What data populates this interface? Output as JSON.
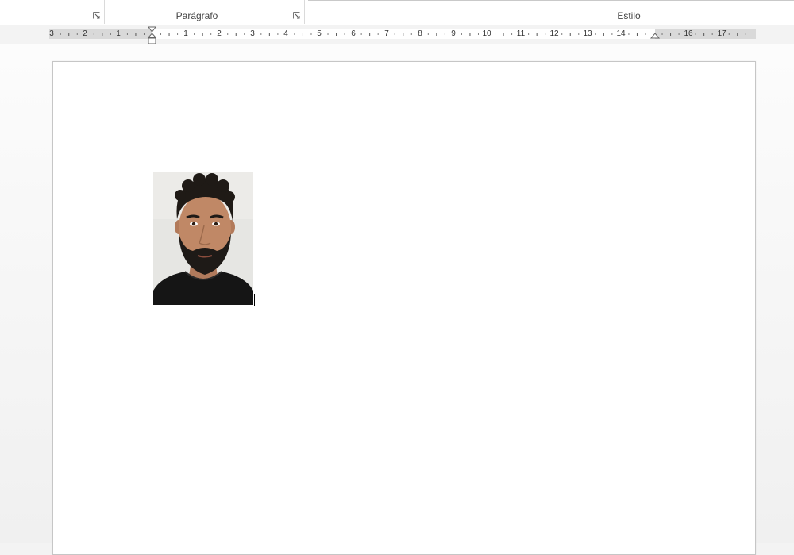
{
  "ribbon": {
    "groups": [
      {
        "label": ""
      },
      {
        "label": "Parágrafo"
      },
      {
        "label": "Estilo"
      }
    ]
  },
  "ruler": {
    "left_numbers": [
      "3",
      "2",
      "1"
    ],
    "right_numbers": [
      "1",
      "2",
      "3",
      "4",
      "5",
      "6",
      "7",
      "8",
      "9",
      "10",
      "11",
      "12",
      "13",
      "14",
      "16",
      "17"
    ]
  },
  "document": {
    "photo_alt": "Foto"
  },
  "colors": {
    "ruler_margin": "#d9d9d9",
    "ruler_text": "#333333",
    "page": "#ffffff",
    "background": "#f3f3f3"
  },
  "icons": [
    "dialog-launcher-icon",
    "first-line-indent-icon",
    "hanging-indent-icon",
    "left-indent-icon",
    "right-indent-icon"
  ]
}
